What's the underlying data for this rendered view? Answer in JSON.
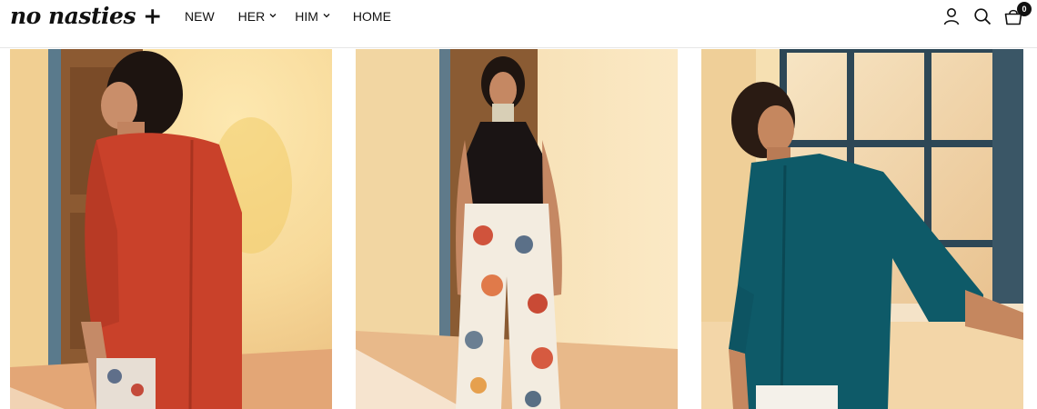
{
  "header": {
    "logo_text": "no nasties +",
    "nav": [
      {
        "label": "NEW",
        "has_dropdown": false
      },
      {
        "label": "HER",
        "has_dropdown": true
      },
      {
        "label": "HIM",
        "has_dropdown": true
      },
      {
        "label": "HOME",
        "has_dropdown": false
      }
    ],
    "icons": [
      "account-icon",
      "search-icon",
      "cart-icon"
    ],
    "cart_count": "0"
  },
  "products": [
    {
      "image": "model-in-red-shirt-back-view",
      "shirt_color": "#c9412a"
    },
    {
      "image": "model-in-black-halter-and-floral-trousers",
      "top_color": "#1a1414"
    },
    {
      "image": "model-in-teal-shirt-by-window",
      "shirt_color": "#0e5a68"
    }
  ],
  "colors": {
    "text": "#111111",
    "border": "#e6e6e6",
    "background": "#ffffff"
  }
}
